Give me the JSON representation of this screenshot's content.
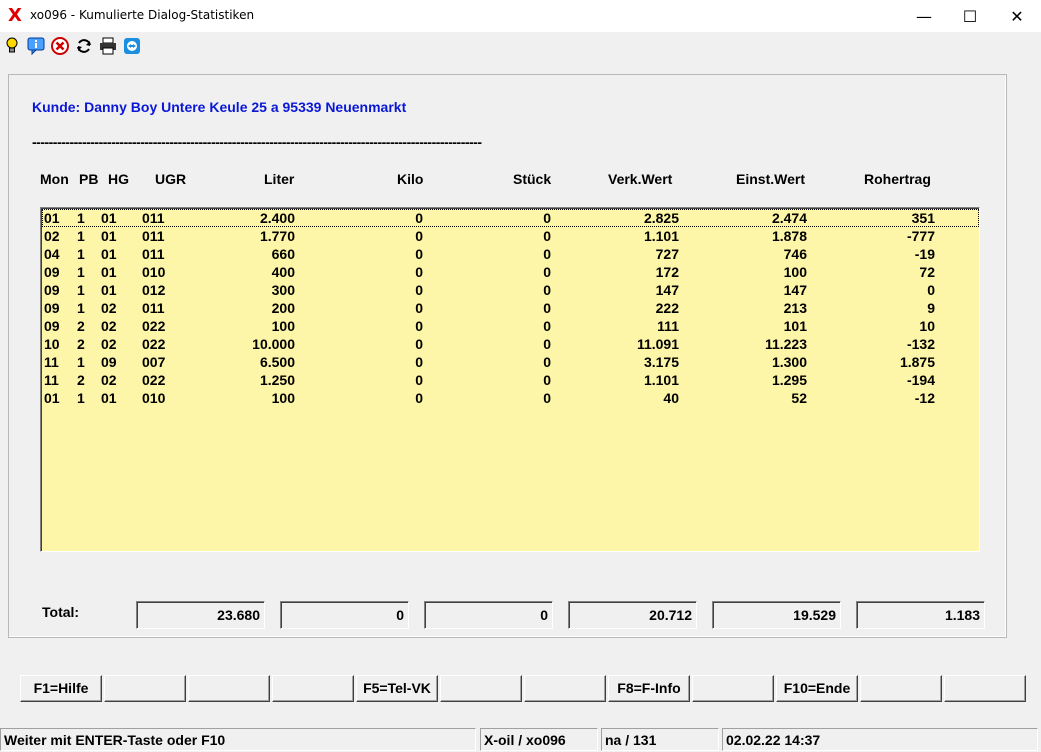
{
  "window": {
    "title": "xo096 - Kumulierte Dialog-Statistiken",
    "icon": "x-logo",
    "app_logo_text": "X",
    "minimize_glyph": "—",
    "maximize_glyph": "☐",
    "close_glyph": "✕"
  },
  "toolbar": {
    "icons": [
      "lightbulb-icon",
      "info-icon",
      "stop-icon",
      "refresh-icon",
      "printer-icon",
      "teamviewer-icon"
    ]
  },
  "customer": {
    "text": "Kunde: Danny Boy Untere Keule 25 a 95339 Neuenmarkt"
  },
  "divider": "------------------------------------------------------------------------------------------------------------",
  "columns": {
    "mon": "Mon",
    "pb": "PB",
    "hg": "HG",
    "ugr": "UGR",
    "liter": "Liter",
    "kilo": "Kilo",
    "stueck": "Stück",
    "verk": "Verk.Wert",
    "einst": "Einst.Wert",
    "roh": "Rohertrag"
  },
  "rows": [
    {
      "mon": "01",
      "pb": "1",
      "hg": "01",
      "ugr": "011",
      "liter": "2.400",
      "kilo": "0",
      "stueck": "0",
      "verk": "2.825",
      "einst": "2.474",
      "roh": "351"
    },
    {
      "mon": "02",
      "pb": "1",
      "hg": "01",
      "ugr": "011",
      "liter": "1.770",
      "kilo": "0",
      "stueck": "0",
      "verk": "1.101",
      "einst": "1.878",
      "roh": "-777"
    },
    {
      "mon": "04",
      "pb": "1",
      "hg": "01",
      "ugr": "011",
      "liter": "660",
      "kilo": "0",
      "stueck": "0",
      "verk": "727",
      "einst": "746",
      "roh": "-19"
    },
    {
      "mon": "09",
      "pb": "1",
      "hg": "01",
      "ugr": "010",
      "liter": "400",
      "kilo": "0",
      "stueck": "0",
      "verk": "172",
      "einst": "100",
      "roh": "72"
    },
    {
      "mon": "09",
      "pb": "1",
      "hg": "01",
      "ugr": "012",
      "liter": "300",
      "kilo": "0",
      "stueck": "0",
      "verk": "147",
      "einst": "147",
      "roh": "0"
    },
    {
      "mon": "09",
      "pb": "1",
      "hg": "02",
      "ugr": "011",
      "liter": "200",
      "kilo": "0",
      "stueck": "0",
      "verk": "222",
      "einst": "213",
      "roh": "9"
    },
    {
      "mon": "09",
      "pb": "2",
      "hg": "02",
      "ugr": "022",
      "liter": "100",
      "kilo": "0",
      "stueck": "0",
      "verk": "111",
      "einst": "101",
      "roh": "10"
    },
    {
      "mon": "10",
      "pb": "2",
      "hg": "02",
      "ugr": "022",
      "liter": "10.000",
      "kilo": "0",
      "stueck": "0",
      "verk": "11.091",
      "einst": "11.223",
      "roh": "-132"
    },
    {
      "mon": "11",
      "pb": "1",
      "hg": "09",
      "ugr": "007",
      "liter": "6.500",
      "kilo": "0",
      "stueck": "0",
      "verk": "3.175",
      "einst": "1.300",
      "roh": "1.875"
    },
    {
      "mon": "11",
      "pb": "2",
      "hg": "02",
      "ugr": "022",
      "liter": "1.250",
      "kilo": "0",
      "stueck": "0",
      "verk": "1.101",
      "einst": "1.295",
      "roh": "-194"
    },
    {
      "mon": "01",
      "pb": "1",
      "hg": "01",
      "ugr": "010",
      "liter": "100",
      "kilo": "0",
      "stueck": "0",
      "verk": "40",
      "einst": "52",
      "roh": "-12"
    }
  ],
  "totals": {
    "label": "Total:",
    "liter": "23.680",
    "kilo": "0",
    "stueck": "0",
    "verk": "20.712",
    "einst": "19.529",
    "roh": "1.183"
  },
  "fkeys": [
    "F1=Hilfe",
    "",
    "",
    "",
    "F5=Tel-VK",
    "",
    "",
    "F8=F-Info",
    "",
    "F10=Ende",
    "",
    ""
  ],
  "status": {
    "message": "Weiter mit ENTER-Taste oder F10",
    "program": "X-oil / xo096",
    "user": "na / 131",
    "datetime": "02.02.22 14:37"
  },
  "colors": {
    "customer_text": "#0a18d6",
    "grid_background": "#fdf5a7",
    "window_background": "#f0f0f0",
    "logo": "#e00000"
  }
}
